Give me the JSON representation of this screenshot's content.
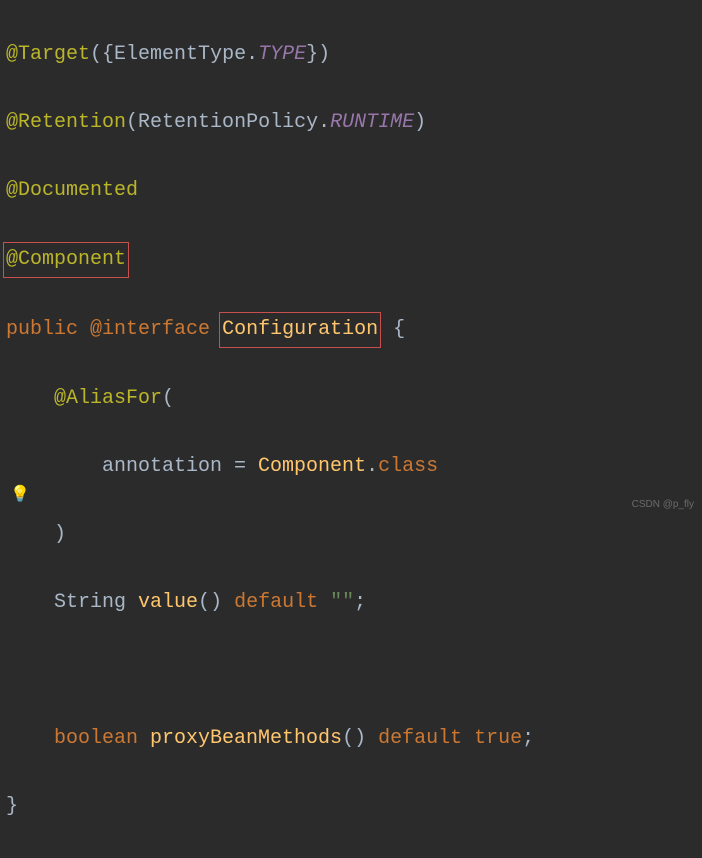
{
  "code": {
    "at_target": "@Target",
    "lparen": "(",
    "rparen": ")",
    "lbrace_set": "{",
    "rbrace_set": "}",
    "element_type": "ElementType",
    "dot": ".",
    "type_const": "TYPE",
    "at_retention": "@Retention",
    "retention_policy": "RetentionPolicy",
    "runtime_const": "RUNTIME",
    "at_documented": "@Documented",
    "at_component": "@Component",
    "kw_public": "public",
    "kw_interface": "@interface",
    "cls_configuration": "Configuration",
    "lbrace": "{",
    "rbrace": "}",
    "at_aliasfor": "@AliasFor",
    "param_annotation": "annotation",
    "eq": " = ",
    "component_ref": "Component",
    "kw_class": "class",
    "type_string": "String",
    "m_value": "value",
    "kw_default": "default",
    "empty_str": "\"\"",
    "semi": ";",
    "type_boolean": "boolean",
    "m_proxy": "proxyBeanMethods",
    "kw_true": "true"
  },
  "watermark": "CSDN @p_fly",
  "bulb_icon": "💡"
}
